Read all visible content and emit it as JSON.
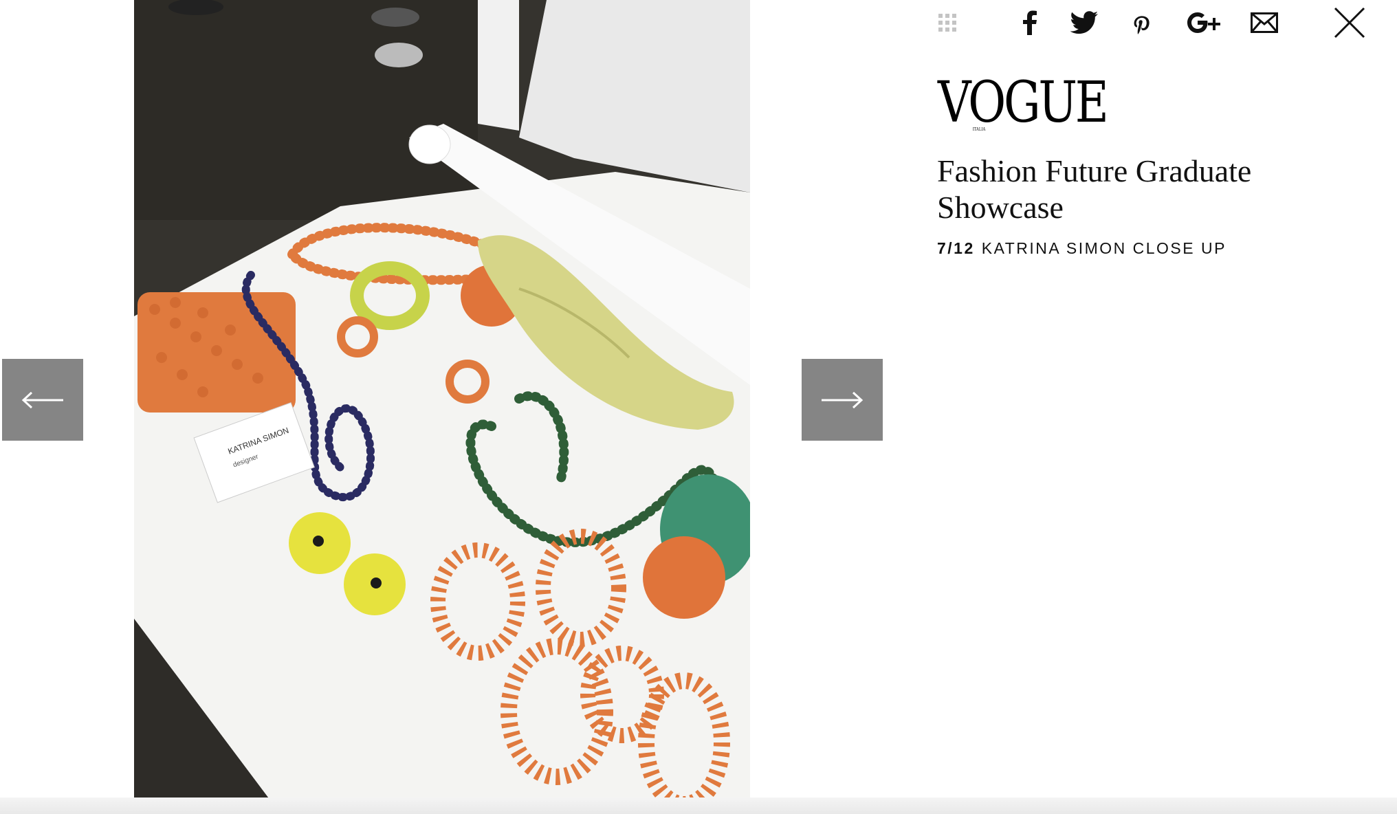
{
  "brand": {
    "name": "VOGUE",
    "subname": "ITALIA"
  },
  "gallery": {
    "title": "Fashion Future Graduate Showcase",
    "current": "7/12",
    "caption": "KATRINA SIMON CLOSE UP",
    "business_card": {
      "name": "KATRINA SIMON",
      "role": "designer"
    }
  },
  "toolbar": {
    "items": [
      "grid-icon",
      "facebook-icon",
      "twitter-icon",
      "pinterest-icon",
      "google-plus-icon",
      "email-icon",
      "close-icon"
    ]
  },
  "nav": {
    "prev": "←",
    "next": "→"
  }
}
